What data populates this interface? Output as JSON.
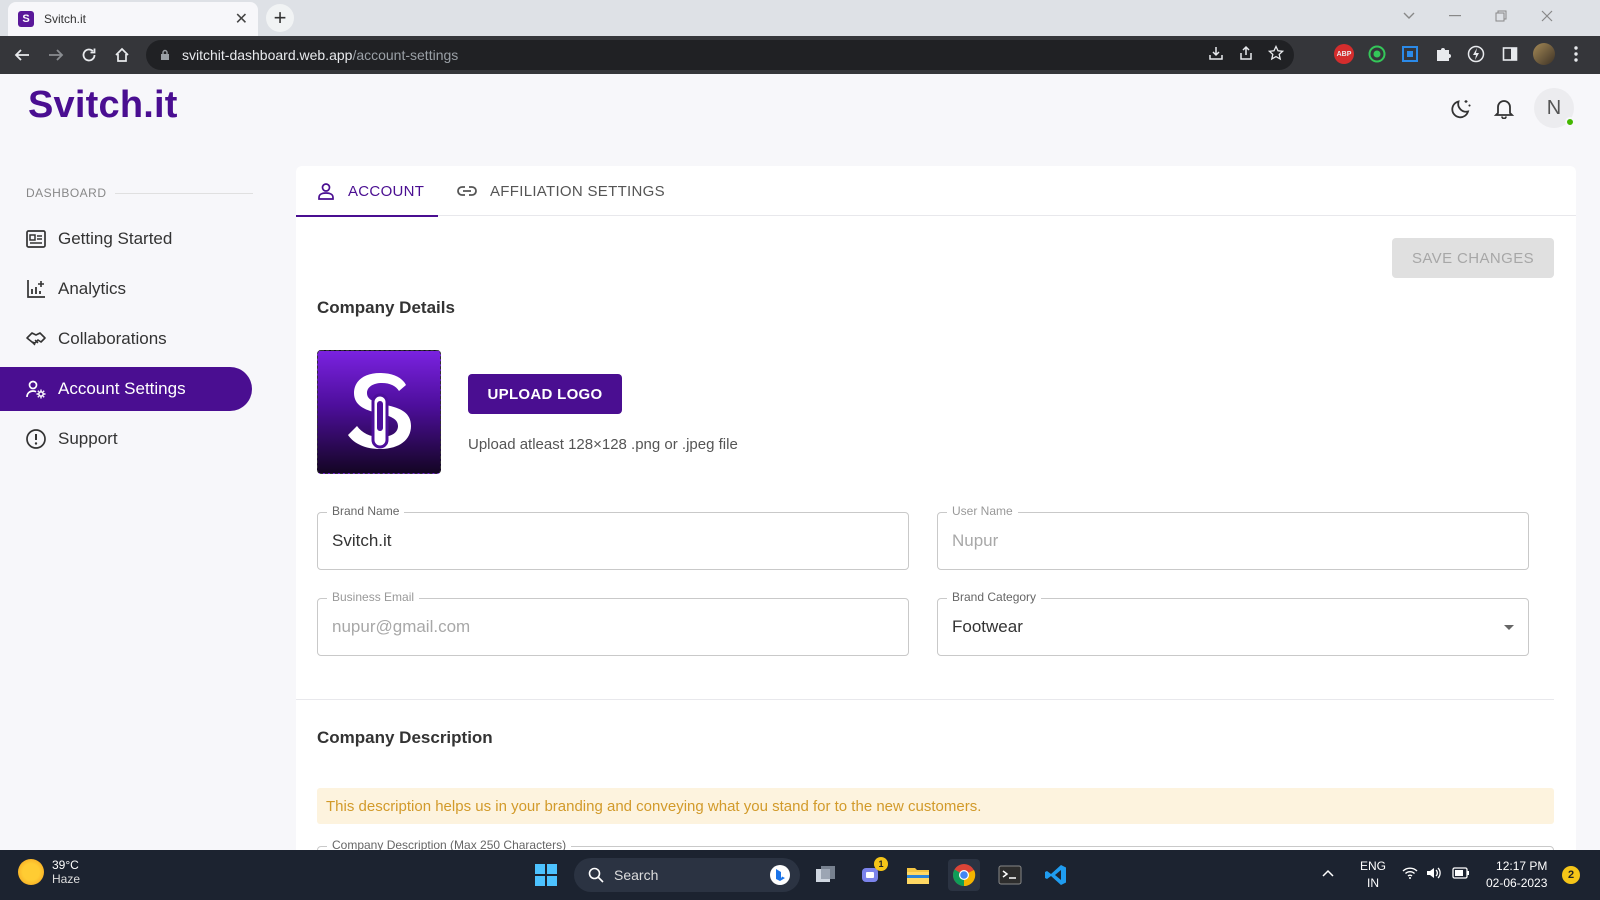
{
  "browser": {
    "tab_title": "Svitch.it",
    "tab_favicon": "S",
    "close_glyph": "✕",
    "newtab_glyph": "+",
    "url_host": "svitchit-dashboard.web.app",
    "url_path": "/account-settings",
    "ext_abp": "ABP"
  },
  "app": {
    "logo": "Svitch.it",
    "avatar_initial": "N",
    "accent_color": "#4a0e91"
  },
  "sidebar": {
    "section_label": "DASHBOARD",
    "items": [
      {
        "label": "Getting Started",
        "icon": "newspaper-icon",
        "active": false
      },
      {
        "label": "Analytics",
        "icon": "analytics-icon",
        "active": false
      },
      {
        "label": "Collaborations",
        "icon": "handshake-icon",
        "active": false
      },
      {
        "label": "Account Settings",
        "icon": "user-settings-icon",
        "active": true
      },
      {
        "label": "Support",
        "icon": "info-circle-icon",
        "active": false
      }
    ]
  },
  "tabs": [
    {
      "label": "ACCOUNT",
      "icon": "person-icon",
      "active": true
    },
    {
      "label": "AFFILIATION SETTINGS",
      "icon": "link-icon",
      "active": false
    }
  ],
  "main": {
    "save_label": "SAVE CHANGES",
    "company_details_heading": "Company Details",
    "upload_logo_label": "UPLOAD LOGO",
    "upload_hint": "Upload atleast 128×128 .png or .jpeg file",
    "company_description_heading": "Company Description",
    "description_alert": "This description helps us in your branding and conveying what you stand for to the new customers.",
    "description_field_label": "Company Description (Max 250 Characters)"
  },
  "form": {
    "brand_name": {
      "label": "Brand Name",
      "value": "Svitch.it"
    },
    "user_name": {
      "label": "User Name",
      "value": "Nupur"
    },
    "business_email": {
      "label": "Business Email",
      "value": "nupur@gmail.com"
    },
    "brand_category": {
      "label": "Brand Category",
      "value": "Footwear"
    }
  },
  "taskbar": {
    "weather_temp": "39°C",
    "weather_desc": "Haze",
    "search_label": "Search",
    "lang_line1": "ENG",
    "lang_line2": "IN",
    "time": "12:17 PM",
    "date": "02-06-2023",
    "notification_count": "2",
    "teams_badge": "1"
  }
}
